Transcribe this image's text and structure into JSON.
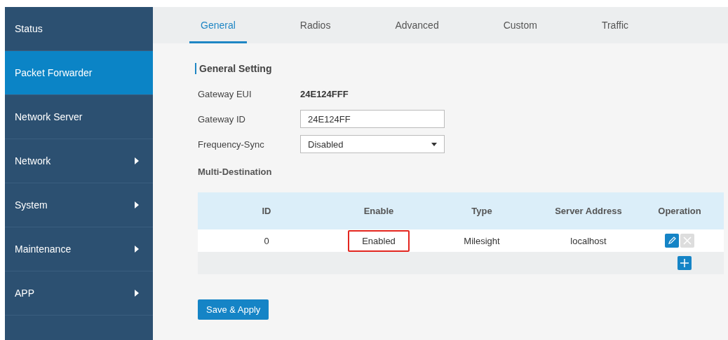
{
  "sidebar": {
    "items": [
      {
        "label": "Status",
        "selected": false,
        "has_submenu": false
      },
      {
        "label": "Packet Forwarder",
        "selected": true,
        "has_submenu": false
      },
      {
        "label": "Network Server",
        "selected": false,
        "has_submenu": false
      },
      {
        "label": "Network",
        "selected": false,
        "has_submenu": true
      },
      {
        "label": "System",
        "selected": false,
        "has_submenu": true
      },
      {
        "label": "Maintenance",
        "selected": false,
        "has_submenu": true
      },
      {
        "label": "APP",
        "selected": false,
        "has_submenu": true
      }
    ]
  },
  "tabs": [
    {
      "label": "General",
      "selected": true
    },
    {
      "label": "Radios",
      "selected": false
    },
    {
      "label": "Advanced",
      "selected": false
    },
    {
      "label": "Custom",
      "selected": false
    },
    {
      "label": "Traffic",
      "selected": false
    }
  ],
  "section_title": "General Setting",
  "fields": [
    {
      "kind": "text",
      "label": "Gateway EUI",
      "value": "24E124FFF"
    },
    {
      "kind": "input",
      "label": "Gateway ID",
      "value": "24E124FF"
    },
    {
      "kind": "select",
      "label": "Frequency-Sync",
      "value": "Disabled"
    }
  ],
  "multi_destination": {
    "title": "Multi-Destination",
    "columns": [
      "ID",
      "Enable",
      "Type",
      "Server Address",
      "Operation"
    ],
    "rows": [
      {
        "id": "0",
        "enable": "Enabled",
        "enable_highlighted": true,
        "type": "Milesight",
        "server_address": "localhost"
      }
    ]
  },
  "save_button": "Save & Apply"
}
